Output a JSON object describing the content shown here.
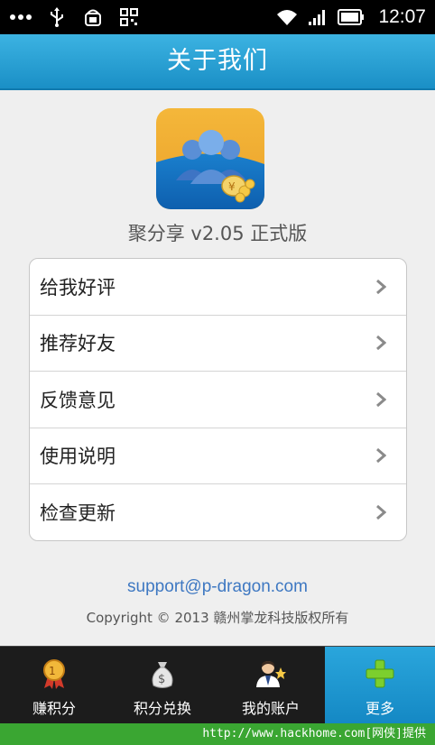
{
  "status_bar": {
    "time": "12:07",
    "icons": [
      "more-dots-icon",
      "usb-icon",
      "android-debug-icon",
      "qr-code-icon",
      "wifi-icon",
      "signal-icon",
      "battery-icon"
    ]
  },
  "header": {
    "title": "关于我们"
  },
  "app": {
    "version_text": "聚分享 v2.05  正式版"
  },
  "menu": {
    "items": [
      {
        "label": "给我好评"
      },
      {
        "label": "推荐好友"
      },
      {
        "label": "反馈意见"
      },
      {
        "label": "使用说明"
      },
      {
        "label": "检查更新"
      }
    ]
  },
  "footer": {
    "email": "support@p-dragon.com",
    "copyright": "Copyright © 2013 赣州掌龙科技版权所有"
  },
  "bottom_nav": {
    "items": [
      {
        "label": "赚积分",
        "icon": "medal-icon"
      },
      {
        "label": "积分兑换",
        "icon": "money-bag-icon"
      },
      {
        "label": "我的账户",
        "icon": "user-account-icon"
      },
      {
        "label": "更多",
        "icon": "plus-icon"
      }
    ],
    "active_index": 3
  },
  "watermark": {
    "text": "http://www.hackhome.com[网侠]提供"
  },
  "colors": {
    "accent": "#1a8fc6",
    "link": "#3e78c2",
    "watermark_bg": "#3aa632"
  }
}
